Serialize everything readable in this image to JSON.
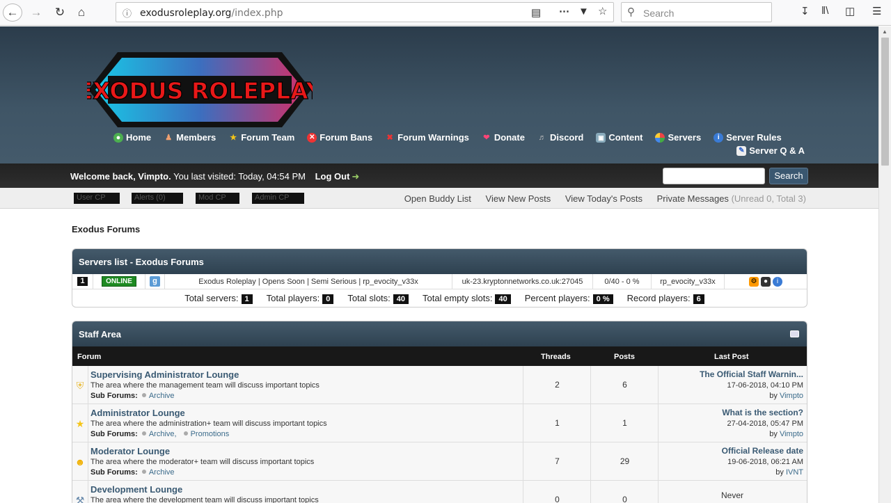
{
  "browser": {
    "url_host": "exodusroleplay.org",
    "url_path": "/index.php",
    "search_placeholder": "Search"
  },
  "header": {
    "logo_text": "EXODUS ROLEPLAY",
    "nav_row1": [
      {
        "label": "Home",
        "icon": "globe-icon"
      },
      {
        "label": "Members",
        "icon": "user-icon"
      },
      {
        "label": "Forum Team",
        "icon": "star-icon"
      },
      {
        "label": "Forum Bans",
        "icon": "x-circle-icon"
      },
      {
        "label": "Forum Warnings",
        "icon": "x-icon"
      },
      {
        "label": "Donate",
        "icon": "heart-icon"
      },
      {
        "label": "Discord",
        "icon": "speaker-icon"
      },
      {
        "label": "Content",
        "icon": "monitor-icon"
      },
      {
        "label": "Servers",
        "icon": "pie-icon"
      },
      {
        "label": "Server Rules",
        "icon": "info-icon"
      }
    ],
    "nav_row2": [
      {
        "label": "Server Q & A",
        "icon": "notepad-icon"
      }
    ]
  },
  "welcome": {
    "greeting": "Welcome back, Vimpto.",
    "last_visit": "You last visited: Today, 04:54 PM",
    "logout": "Log Out",
    "search_button": "Search"
  },
  "subbar": {
    "cp_buttons": [
      "User CP",
      "Alerts (0)",
      "Mod CP",
      "Admin CP"
    ],
    "links": [
      "Open Buddy List",
      "View New Posts",
      "View Today's Posts",
      "Private Messages"
    ],
    "pm_counts": "(Unread 0, Total 3)"
  },
  "breadcrumb": "Exodus Forums",
  "servers": {
    "title": "Servers list - Exodus Forums",
    "row": {
      "num": "1",
      "status": "ONLINE",
      "game_icon": "g",
      "name": "Exodus Roleplay | Opens Soon | Semi Serious | rp_evocity_v33x",
      "address": "uk-23.kryptonnetworks.co.uk:27045",
      "players": "0/40 - 0 %",
      "map": "rp_evocity_v33x"
    },
    "totals": [
      {
        "label": "Total servers:",
        "value": "1"
      },
      {
        "label": "Total players:",
        "value": "0"
      },
      {
        "label": "Total slots:",
        "value": "40"
      },
      {
        "label": "Total empty slots:",
        "value": "40"
      },
      {
        "label": "Percent players:",
        "value": "0 %"
      },
      {
        "label": "Record players:",
        "value": "6"
      }
    ]
  },
  "staff": {
    "title": "Staff Area",
    "columns": {
      "forum": "Forum",
      "threads": "Threads",
      "posts": "Posts",
      "last": "Last Post"
    },
    "subforums_label": "Sub Forums:",
    "forums": [
      {
        "title": "Supervising Administrator Lounge",
        "desc": "The area where the management team will discuss important topics",
        "subforums": [
          "Archive"
        ],
        "threads": "2",
        "posts": "6",
        "last_title": "The Official Staff Warnin...",
        "last_date": "17-06-2018, 04:10 PM",
        "last_by": "by",
        "last_user": "Vimpto"
      },
      {
        "title": "Administrator Lounge",
        "desc": "The area where the administration+ team will discuss important topics",
        "subforums": [
          "Archive,",
          "Promotions"
        ],
        "threads": "1",
        "posts": "1",
        "last_title": "What is the section?",
        "last_date": "27-04-2018, 05:47 PM",
        "last_by": "by",
        "last_user": "Vimpto"
      },
      {
        "title": "Moderator Lounge",
        "desc": "The area where the moderator+ team will discuss important topics",
        "subforums": [
          "Archive"
        ],
        "threads": "7",
        "posts": "29",
        "last_title": "Official Release date",
        "last_date": "19-06-2018, 06:21 AM",
        "last_by": "by",
        "last_user": "IVNT"
      },
      {
        "title": "Development Lounge",
        "desc": "The area where the development team will discuss important topics",
        "threads": "0",
        "posts": "0",
        "last_never": "Never"
      }
    ]
  }
}
